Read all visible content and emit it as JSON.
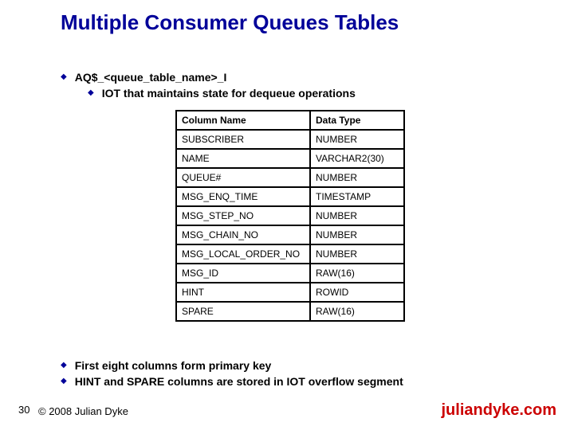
{
  "title": "Multiple Consumer Queues Tables",
  "bullets": {
    "main": "AQ$_<queue_table_name>_I",
    "sub": "IOT that maintains state for dequeue operations",
    "note1": "First eight columns form primary key",
    "note2": "HINT and SPARE columns are stored in IOT overflow segment"
  },
  "table": {
    "headers": {
      "c1": "Column Name",
      "c2": "Data Type"
    },
    "rows": [
      {
        "c1": "SUBSCRIBER",
        "c2": "NUMBER"
      },
      {
        "c1": "NAME",
        "c2": "VARCHAR2(30)"
      },
      {
        "c1": "QUEUE#",
        "c2": "NUMBER"
      },
      {
        "c1": "MSG_ENQ_TIME",
        "c2": "TIMESTAMP"
      },
      {
        "c1": "MSG_STEP_NO",
        "c2": "NUMBER"
      },
      {
        "c1": "MSG_CHAIN_NO",
        "c2": "NUMBER"
      },
      {
        "c1": "MSG_LOCAL_ORDER_NO",
        "c2": "NUMBER"
      },
      {
        "c1": "MSG_ID",
        "c2": "RAW(16)"
      },
      {
        "c1": "HINT",
        "c2": "ROWID"
      },
      {
        "c1": "SPARE",
        "c2": "RAW(16)"
      }
    ]
  },
  "footer": {
    "page": "30",
    "copyright": "© 2008 Julian Dyke",
    "site": "juliandyke.com"
  }
}
